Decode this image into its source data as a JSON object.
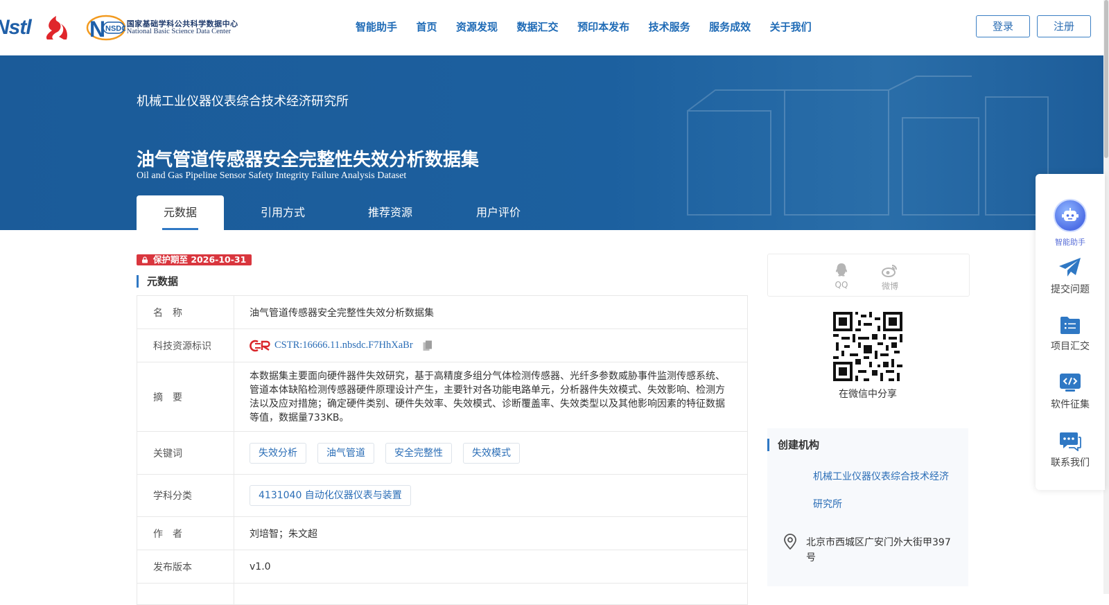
{
  "header": {
    "logo_nstl": "Nstl",
    "logo_nsdc_cn": "国家基础学科公共科学数据中心",
    "logo_nsdc_en": "National Basic Science Data Center",
    "logo_nsdc_mark": "NSDC",
    "nav": [
      "智能助手",
      "首页",
      "资源发现",
      "数据汇交",
      "预印本发布",
      "技术服务",
      "服务成效",
      "关于我们"
    ],
    "login": "登录",
    "register": "注册"
  },
  "banner": {
    "organization": "机械工业仪器仪表综合技术经济研究所",
    "title": "油气管道传感器安全完整性失效分析数据集",
    "subtitle": "Oil and Gas Pipeline Sensor Safety Integrity Failure Analysis Dataset",
    "tabs": [
      "元数据",
      "引用方式",
      "推荐资源",
      "用户评价"
    ],
    "active_tab": "元数据"
  },
  "main": {
    "protection_badge": "保护期至 2026-10-31",
    "section_title": "元数据",
    "rows": {
      "name": {
        "label": "名　称",
        "value": "油气管道传感器安全完整性失效分析数据集"
      },
      "cstr": {
        "label": "科技资源标识",
        "value": "CSTR:16666.11.nbsdc.F7HhXaBr"
      },
      "abstract": {
        "label": "摘　要",
        "value": "本数据集主要面向硬件器件失效研究，基于高精度多组分气体检测传感器、光纤多参数威胁事件监测传感系统、管道本体缺陷检测传感器硬件原理设计产生，主要针对各功能电路单元，分析器件失效模式、失效影响、检测方法以及应对措施；确定硬件类别、硬件失效率、失效模式、诊断覆盖率、失效类型以及其他影响因素的特征数据等值，数据量733KB。"
      },
      "keywords": {
        "label": "关键词",
        "values": [
          "失效分析",
          "油气管道",
          "安全完整性",
          "失效模式"
        ]
      },
      "subject": {
        "label": "学科分类",
        "value": "4131040 自动化仪器仪表与装置"
      },
      "authors": {
        "label": "作　者",
        "value": "刘培智；朱文超"
      },
      "version": {
        "label": "发布版本",
        "value": "v1.0"
      }
    }
  },
  "sidebar": {
    "share_qq": "QQ",
    "share_weibo": "微博",
    "qr_caption": "在微信中分享",
    "creator_title": "创建机构",
    "creator_name": "机械工业仪器仪表综合技术经济研究所",
    "creator_address": "北京市西城区广安门外大街甲397号"
  },
  "float_toolbar": {
    "ai": "智能助手",
    "submit": "提交问题",
    "project": "项目汇交",
    "software": "软件征集",
    "contact": "联系我们"
  },
  "colors": {
    "brand_blue": "#1f6bb6",
    "banner_blue": "#1c609f",
    "badge_red": "#d9363e",
    "accent": "#2f78c4"
  },
  "icons": [
    "lock-icon",
    "qq-icon",
    "weibo-icon",
    "copy-icon",
    "location-pin-icon",
    "robot-icon",
    "paper-plane-icon",
    "folder-list-icon",
    "code-icon",
    "chat-icon"
  ]
}
